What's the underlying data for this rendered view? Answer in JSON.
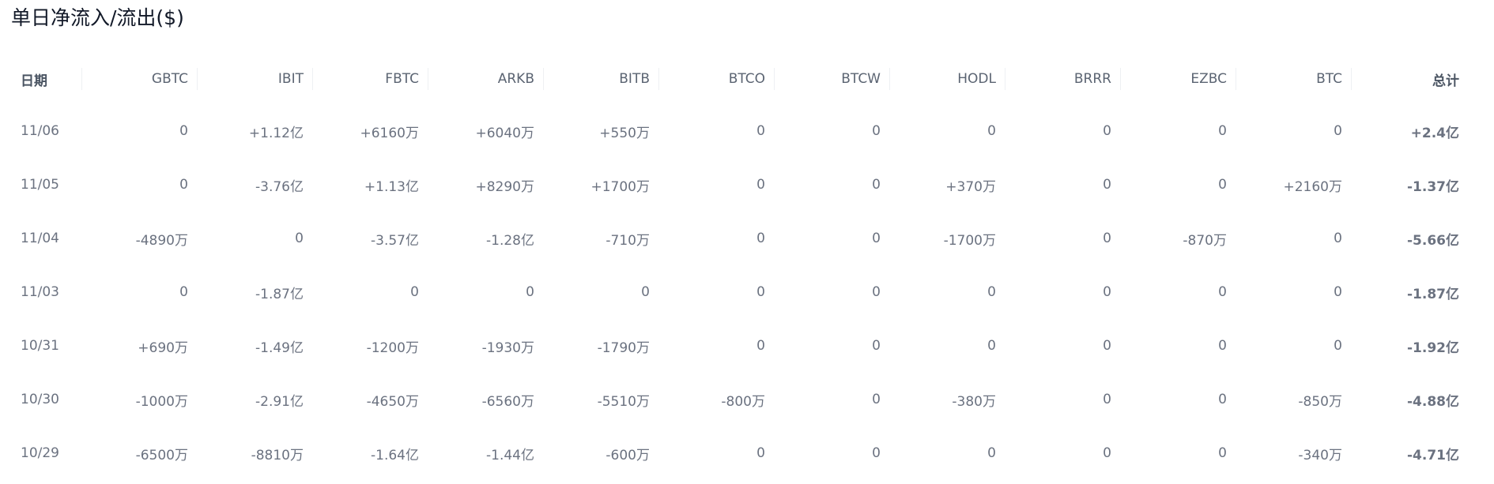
{
  "title": "单日净流入/流出($)",
  "columns": [
    "日期",
    "GBTC",
    "IBIT",
    "FBTC",
    "ARKB",
    "BITB",
    "BTCO",
    "BTCW",
    "HODL",
    "BRRR",
    "EZBC",
    "BTC",
    "总计"
  ],
  "rows": [
    {
      "date": "11/06",
      "values": [
        "0",
        "+1.12亿",
        "+6160万",
        "+6040万",
        "+550万",
        "0",
        "0",
        "0",
        "0",
        "0",
        "0"
      ],
      "total": "+2.4亿"
    },
    {
      "date": "11/05",
      "values": [
        "0",
        "-3.76亿",
        "+1.13亿",
        "+8290万",
        "+1700万",
        "0",
        "0",
        "+370万",
        "0",
        "0",
        "+2160万"
      ],
      "total": "-1.37亿"
    },
    {
      "date": "11/04",
      "values": [
        "-4890万",
        "0",
        "-3.57亿",
        "-1.28亿",
        "-710万",
        "0",
        "0",
        "-1700万",
        "0",
        "-870万",
        "0"
      ],
      "total": "-5.66亿"
    },
    {
      "date": "11/03",
      "values": [
        "0",
        "-1.87亿",
        "0",
        "0",
        "0",
        "0",
        "0",
        "0",
        "0",
        "0",
        "0"
      ],
      "total": "-1.87亿"
    },
    {
      "date": "10/31",
      "values": [
        "+690万",
        "-1.49亿",
        "-1200万",
        "-1930万",
        "-1790万",
        "0",
        "0",
        "0",
        "0",
        "0",
        "0"
      ],
      "total": "-1.92亿"
    },
    {
      "date": "10/30",
      "values": [
        "-1000万",
        "-2.91亿",
        "-4650万",
        "-6560万",
        "-5510万",
        "-800万",
        "0",
        "-380万",
        "0",
        "0",
        "-850万"
      ],
      "total": "-4.88亿"
    },
    {
      "date": "10/29",
      "values": [
        "-6500万",
        "-8810万",
        "-1.64亿",
        "-1.44亿",
        "-600万",
        "0",
        "0",
        "0",
        "0",
        "0",
        "-340万"
      ],
      "total": "-4.71亿"
    }
  ],
  "colors": {
    "positive": "#22b07d",
    "negative": "#ea4d5f",
    "neutral": "#6b7280",
    "header": "#5b6472"
  }
}
